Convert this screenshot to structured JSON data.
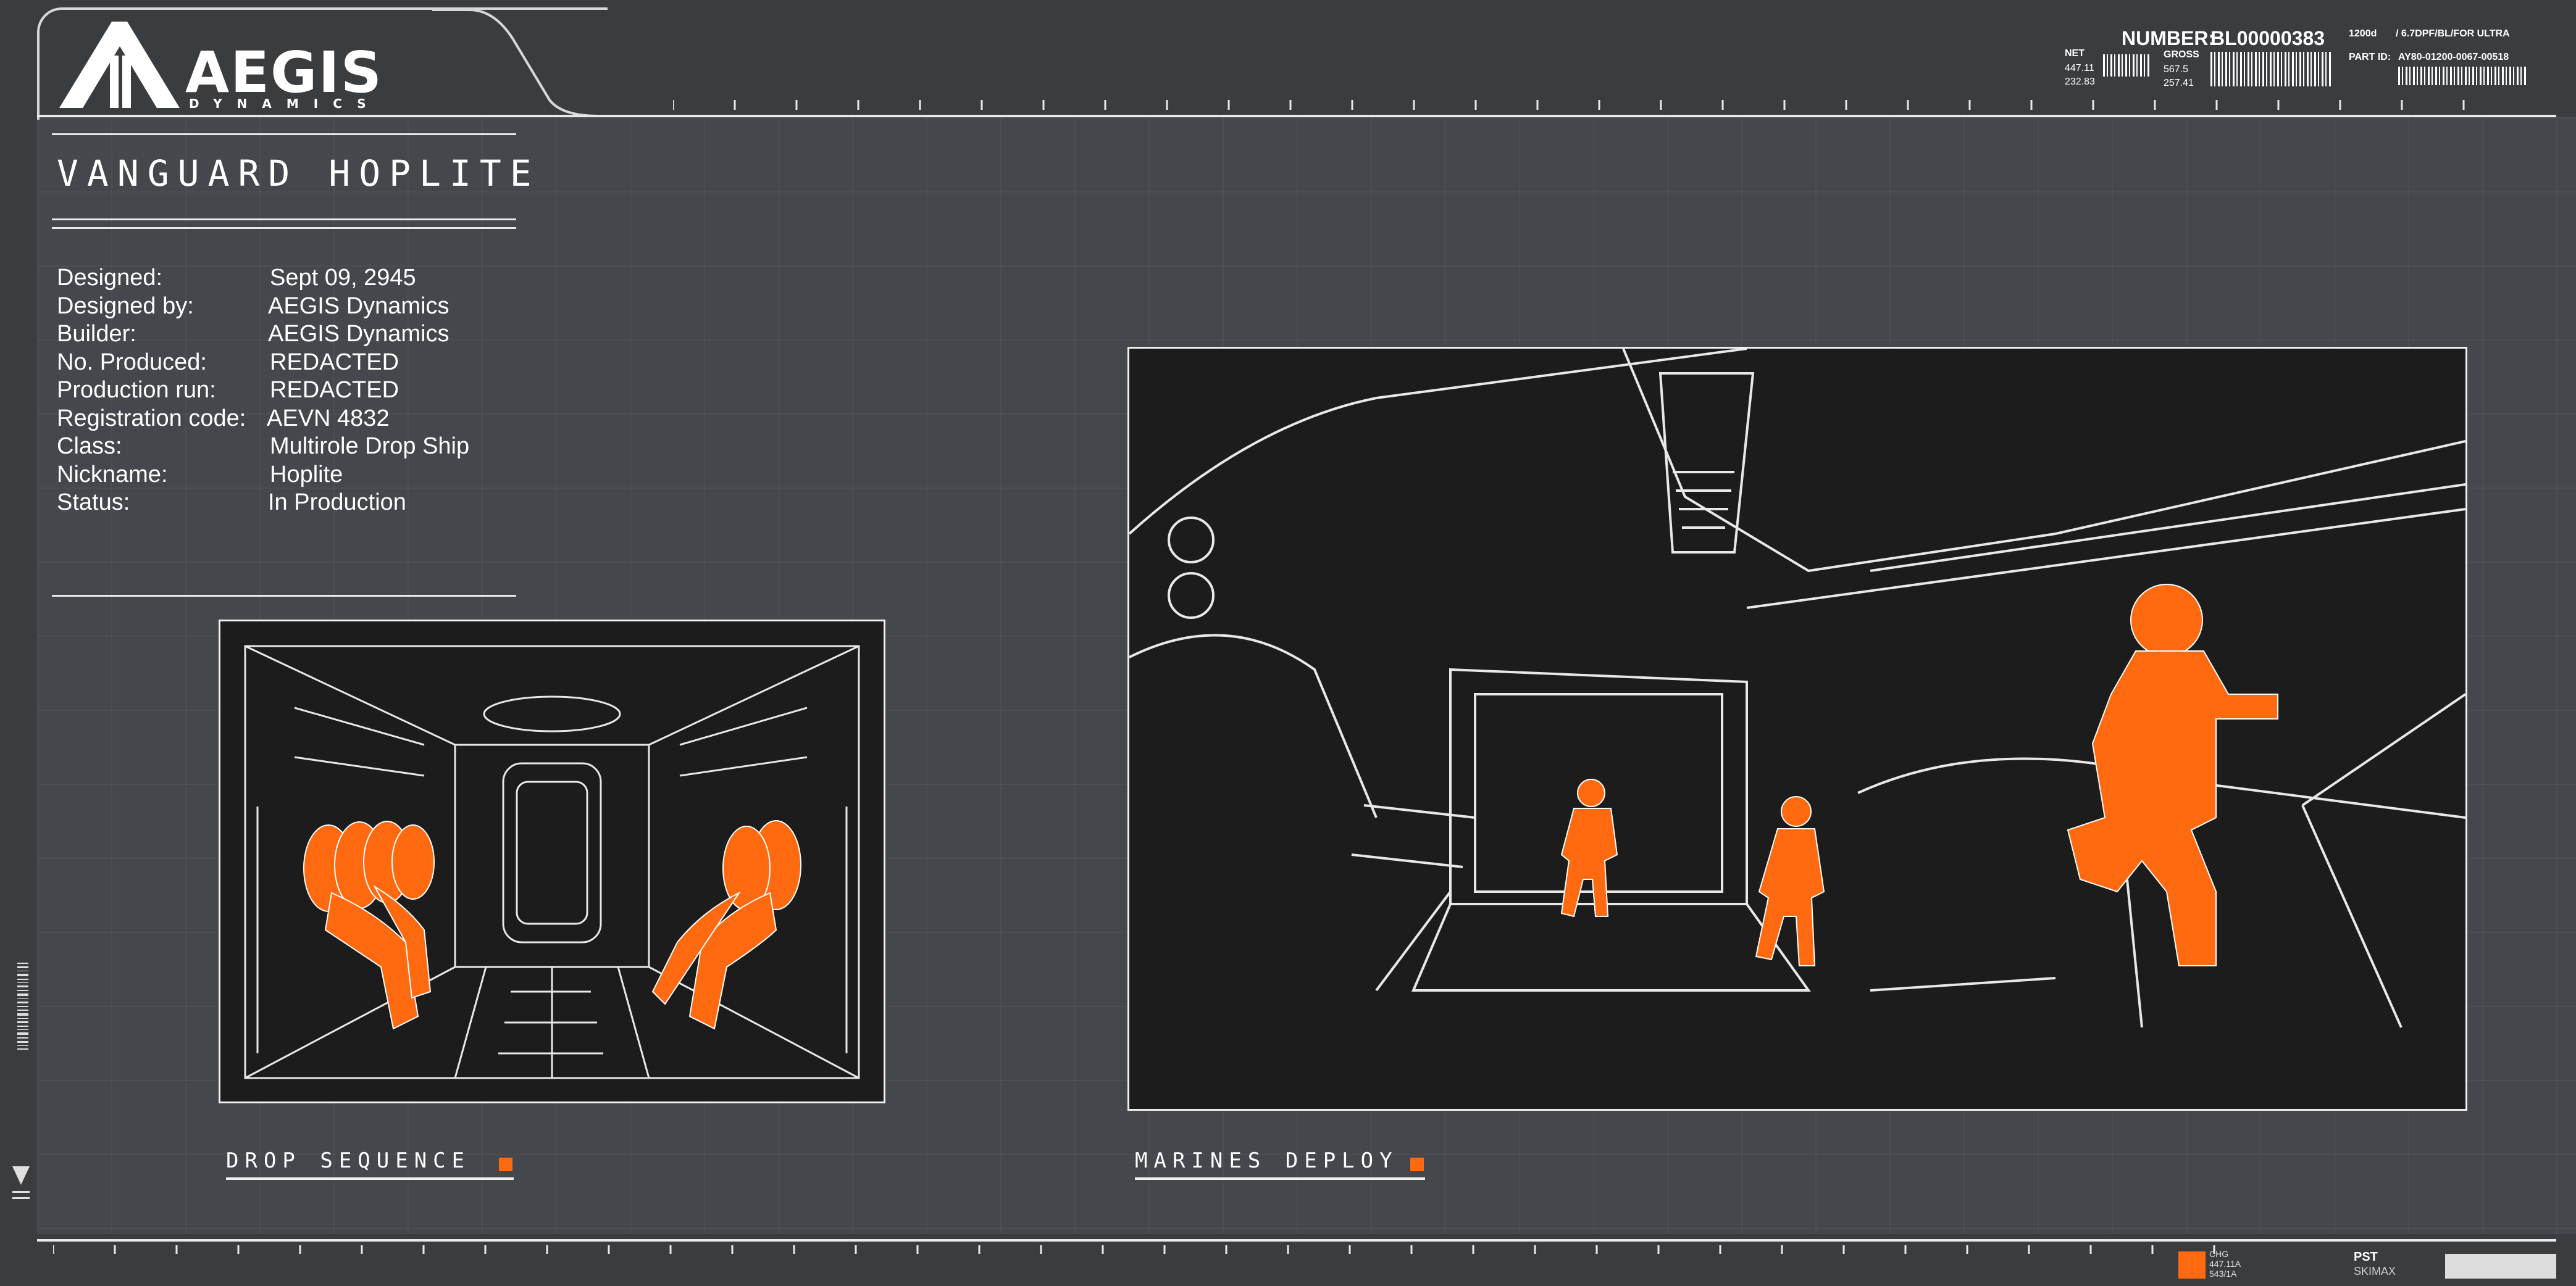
{
  "brand": {
    "name": "AEGIS",
    "sub": "DYNAMICS"
  },
  "header_info": {
    "number_label": "NUMBER:",
    "number_value": "BL00000383",
    "net_label": "NET",
    "net_values": [
      "447.11",
      "232.83"
    ],
    "gross_label": "GROSS",
    "gross_values": [
      "567.5",
      "257.41"
    ],
    "code_a": "1200d",
    "code_b": "/ 6.7DPF/BL/FOR ULTRA",
    "part_label": "PART ID:",
    "part_value": "AY80-01200-0067-00518"
  },
  "title": "VANGUARD HOPLITE",
  "specs": [
    {
      "label": "Designed:",
      "value": "Sept 09, 2945"
    },
    {
      "label": "Designed by:",
      "value": "AEGIS Dynamics"
    },
    {
      "label": "Builder:",
      "value": "AEGIS Dynamics"
    },
    {
      "label": "No. Produced:",
      "value": "REDACTED"
    },
    {
      "label": "Production run:",
      "value": "REDACTED"
    },
    {
      "label": "Registration code:",
      "value": "AEVN 4832"
    },
    {
      "label": "Class:",
      "value": "Multirole Drop Ship"
    },
    {
      "label": "Nickname:",
      "value": "Hoplite"
    },
    {
      "label": "Status:",
      "value": "In Production"
    }
  ],
  "panels": [
    {
      "caption": "DROP SEQUENCE"
    },
    {
      "caption": "MARINES DEPLOY"
    }
  ],
  "footer": {
    "legend_a": "CHG",
    "legend_b": "447.11A",
    "legend_c": "543/1A",
    "pst": "PST",
    "mark": "SKIMAX"
  },
  "colors": {
    "accent": "#ff6a10",
    "background": "#3a3d40",
    "line": "#e9e9e9"
  }
}
